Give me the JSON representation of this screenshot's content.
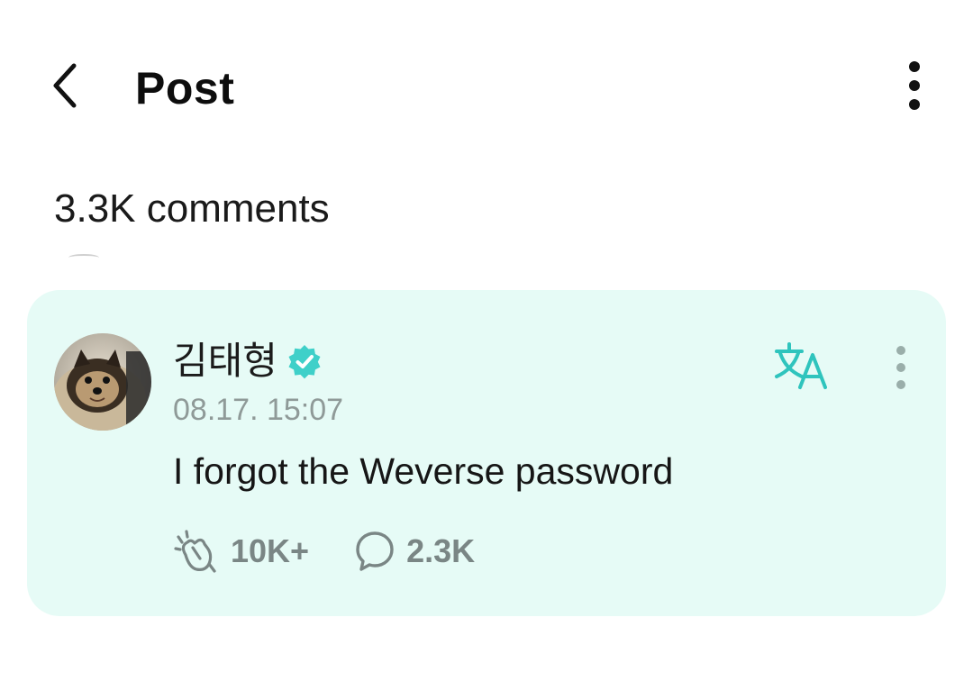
{
  "header": {
    "title": "Post",
    "back_icon": "chevron-left-icon",
    "more_icon": "more-vertical-icon"
  },
  "comments": {
    "count_label": "3.3K comments"
  },
  "post": {
    "author": "김태형",
    "verified": true,
    "timestamp": "08.17. 15:07",
    "body": "I forgot the Weverse password",
    "reactions_count": "10K+",
    "comments_count": "2.3K",
    "avatar_icon": "avatar-dog-photo",
    "translate_icon": "translate-icon"
  },
  "colors": {
    "card_background": "#e6fbf6",
    "accent": "#3fd0c9",
    "muted_text": "#8f9a98",
    "action_gray": "#7a8685"
  }
}
